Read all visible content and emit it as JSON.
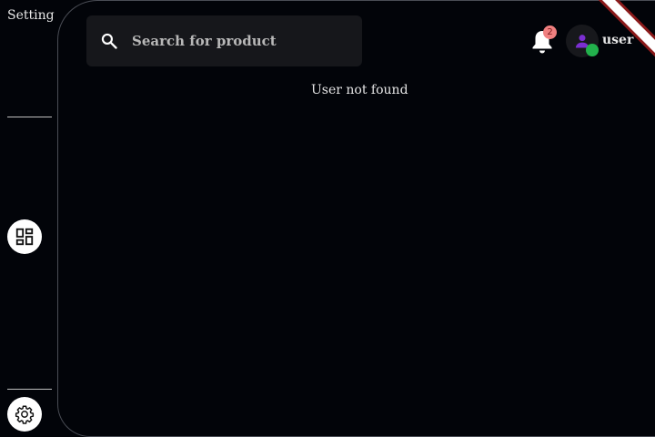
{
  "sidebar": {
    "title": "Setting",
    "items": [
      {
        "name": "dashboard",
        "icon": "dashboard-icon"
      },
      {
        "name": "settings",
        "icon": "gear-icon"
      }
    ]
  },
  "header": {
    "search": {
      "placeholder": "Search for product",
      "value": "",
      "icon": "search-icon"
    },
    "notifications": {
      "icon": "bell-icon",
      "count": "2"
    },
    "user": {
      "icon": "person-icon",
      "name": "user",
      "status": "online"
    }
  },
  "main": {
    "status_message": "User not found"
  },
  "colors": {
    "background": "#020409",
    "search_bg": "#16171b",
    "badge": "#f08080",
    "online": "#22b14c",
    "avatar_icon": "#7b2fd1",
    "debug_banner": "#8b1a1a"
  }
}
